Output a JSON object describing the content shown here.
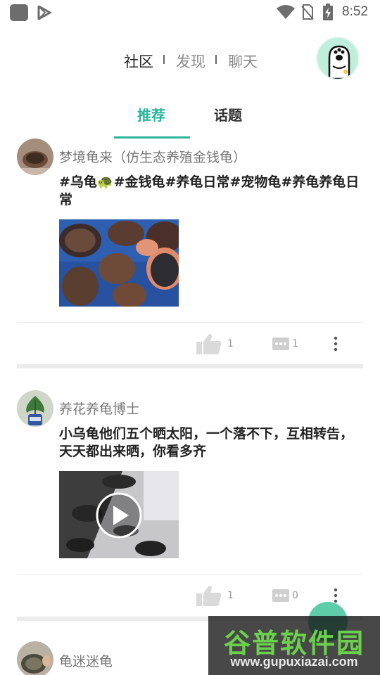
{
  "status_bar": {
    "time": "8:52"
  },
  "top_nav": {
    "items": [
      "社区",
      "发现",
      "聊天"
    ],
    "active": "社区"
  },
  "tabs": {
    "items": [
      "推荐",
      "话题"
    ],
    "active": "推荐"
  },
  "posts": [
    {
      "author": "梦境龟来（仿生态养殖金钱龟）",
      "text": "#乌龟🐢#金钱龟#养龟日常#宠物龟#养龟养龟日常",
      "media": "image",
      "likes": "1",
      "comments": "1"
    },
    {
      "author": "养花养龟博士",
      "text": "小乌龟他们五个晒太阳，一个落不下，互相转告，天天都出来晒，你看多齐",
      "media": "video",
      "likes": "1",
      "comments": "0"
    },
    {
      "author": "龟迷迷龟"
    }
  ],
  "watermark": {
    "title": "谷普软件园",
    "url": "www.gupuxiazai.com"
  },
  "colors": {
    "accent": "#2bb59b",
    "fab": "#4cc6a0"
  },
  "icons": {
    "status": [
      "app-icon",
      "play-store-icon",
      "wifi-icon",
      "no-sim-icon",
      "battery-charging-icon"
    ],
    "actions": [
      "like-icon",
      "comment-icon",
      "more-icon",
      "play-icon"
    ]
  }
}
